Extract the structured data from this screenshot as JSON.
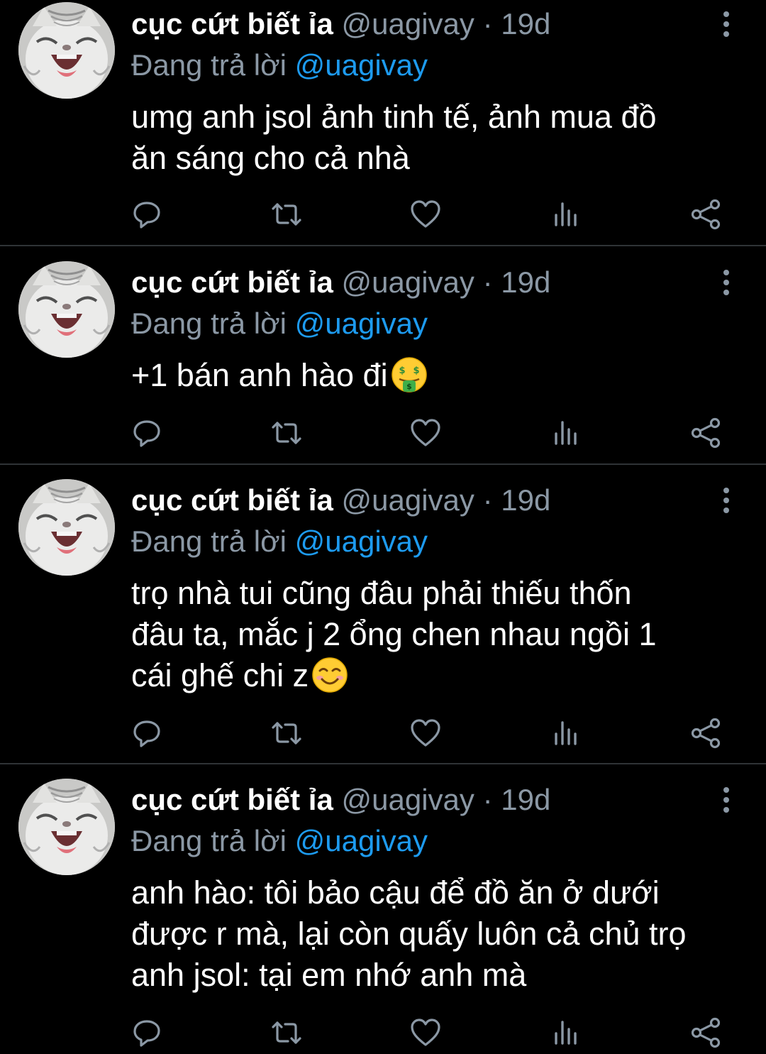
{
  "colors": {
    "background": "#000000",
    "divider": "#2f3336",
    "muted": "#8b98a5",
    "link": "#1d9bf0",
    "text": "#ffffff"
  },
  "tweets": [
    {
      "display_name": "cục cứt biết ỉa",
      "handle": "@uagivay",
      "separator": "·",
      "time": "19d",
      "reply_prefix": "Đang trả lời",
      "reply_handle": "@uagivay",
      "lines": [
        "umg anh jsol ảnh tinh tế, ảnh mua đồ",
        "ăn sáng cho cả nhà"
      ],
      "emoji": null
    },
    {
      "display_name": "cục cứt biết ỉa",
      "handle": "@uagivay",
      "separator": "·",
      "time": "19d",
      "reply_prefix": "Đang trả lời",
      "reply_handle": "@uagivay",
      "lines": [
        "+1 bán anh hào đi"
      ],
      "emoji": "money-mouth-face-emoji"
    },
    {
      "display_name": "cục cứt biết ỉa",
      "handle": "@uagivay",
      "separator": "·",
      "time": "19d",
      "reply_prefix": "Đang trả lời",
      "reply_handle": "@uagivay",
      "lines": [
        "trọ nhà tui cũng đâu phải thiếu thốn",
        "đâu ta, mắc j 2 ổng chen nhau ngồi 1",
        "cái ghế chi z"
      ],
      "emoji": "smiling-face-emoji"
    },
    {
      "display_name": "cục cứt biết ỉa",
      "handle": "@uagivay",
      "separator": "·",
      "time": "19d",
      "reply_prefix": "Đang trả lời",
      "reply_handle": "@uagivay",
      "lines": [
        "anh hào: tôi bảo cậu để đồ ăn ở dưới",
        "được r mà, lại còn quấy luôn cả chủ trọ",
        "anh jsol: tại em nhớ anh mà"
      ],
      "emoji": null
    }
  ],
  "action_icons": [
    "reply-icon",
    "retweet-icon",
    "like-icon",
    "views-icon",
    "share-icon"
  ],
  "more_icon": "more-vertical-icon"
}
